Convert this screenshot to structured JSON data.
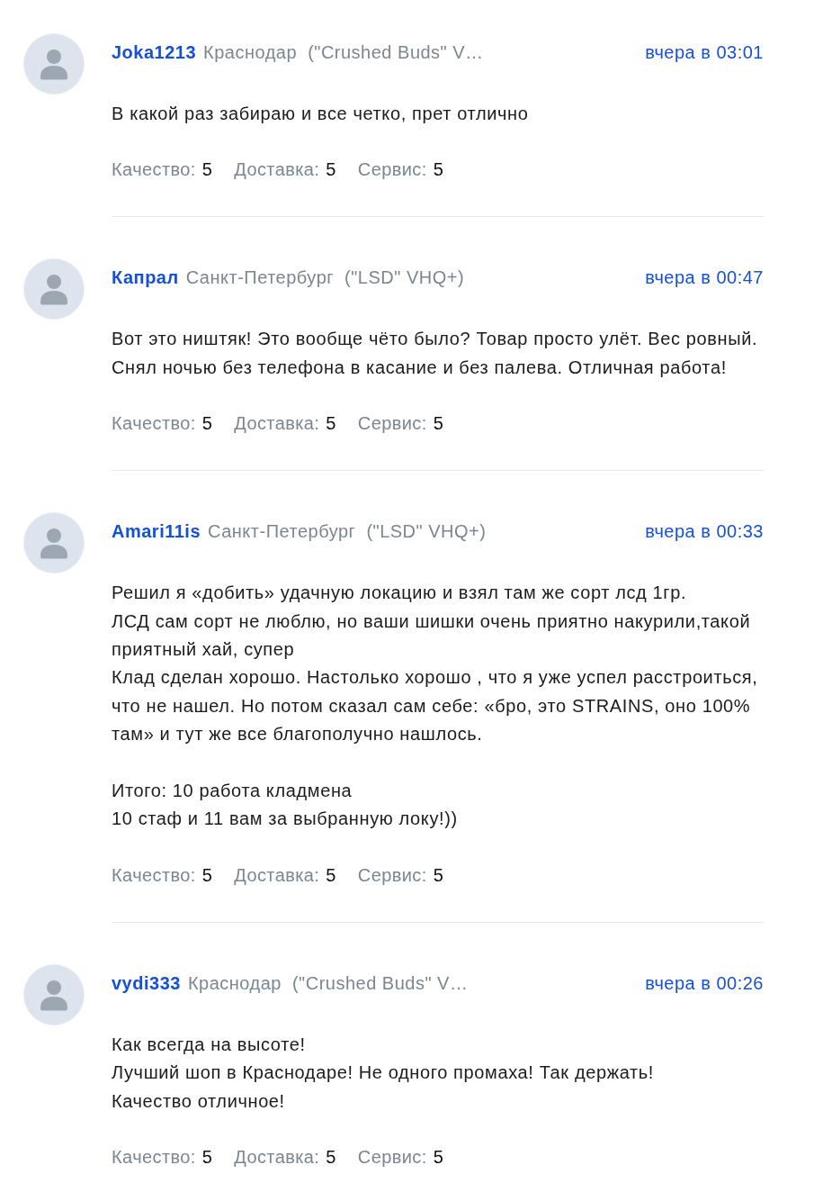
{
  "reviews": [
    {
      "author": "Joka1213",
      "city": "Краснодар",
      "product": "(\"Crushed Buds\" V…",
      "date": "вчера в 03:01",
      "text": "В какой раз забираю и все четко, прет отлично",
      "ratings": [
        {
          "label": "Качество:",
          "value": "5"
        },
        {
          "label": "Доставка:",
          "value": "5"
        },
        {
          "label": "Сервис:",
          "value": "5"
        }
      ]
    },
    {
      "author": "Капрал",
      "city": "Санкт-Петербург",
      "product": "(\"LSD\" VHQ+)",
      "date": "вчера в 00:47",
      "text": "Вот это ништяк! Это вообще чёто было? Товар просто улёт. Вес ровный. Снял ночью без телефона в касание и без палева. Отличная работа!",
      "ratings": [
        {
          "label": "Качество:",
          "value": "5"
        },
        {
          "label": "Доставка:",
          "value": "5"
        },
        {
          "label": "Сервис:",
          "value": "5"
        }
      ]
    },
    {
      "author": "Amari11is",
      "city": "Санкт-Петербург",
      "product": "(\"LSD\" VHQ+)",
      "date": "вчера в 00:33",
      "text": "Решил я «добить» удачную локацию и взял там же сорт лсд 1гр.\nЛСД сам сорт не люблю, но ваши шишки очень приятно накурили,такой приятный хай, супер\nКлад сделан хорошо. Настолько хорошо , что я уже успел расстроиться, что не нашел. Но потом сказал сам себе: «бро, это STRAINS, оно 100% там» и тут же все благополучно нашлось.\n\nИтого: 10 работа кладмена\n10 стаф и 11 вам за выбранную локу!))",
      "ratings": [
        {
          "label": "Качество:",
          "value": "5"
        },
        {
          "label": "Доставка:",
          "value": "5"
        },
        {
          "label": "Сервис:",
          "value": "5"
        }
      ]
    },
    {
      "author": "vydi333",
      "city": "Краснодар",
      "product": "(\"Crushed Buds\" V…",
      "date": "вчера в 00:26",
      "text": "Как всегда на высоте!\nЛучший шоп в Краснодаре! Не одного промаха! Так держать!\nКачество отличное!",
      "ratings": [
        {
          "label": "Качество:",
          "value": "5"
        },
        {
          "label": "Доставка:",
          "value": "5"
        },
        {
          "label": "Сервис:",
          "value": "5"
        }
      ]
    }
  ]
}
